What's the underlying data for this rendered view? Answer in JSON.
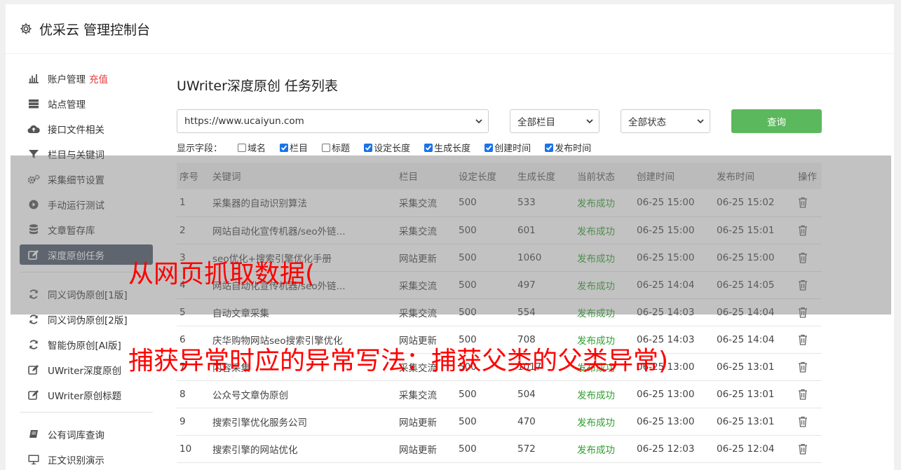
{
  "header": {
    "title": "优采云 管理控制台"
  },
  "sidebar": {
    "items": [
      {
        "label": "账户管理",
        "extra": "充值",
        "icon": "bar-chart-icon"
      },
      {
        "label": "站点管理",
        "icon": "server-icon"
      },
      {
        "label": "接口文件相关",
        "icon": "cloud-upload-icon"
      },
      {
        "label": "栏目与关键词",
        "icon": "filter-icon"
      },
      {
        "label": "采集细节设置",
        "icon": "cogs-icon"
      },
      {
        "label": "手动运行测试",
        "icon": "play-circle-icon"
      },
      {
        "label": "文章暂存库",
        "icon": "database-icon"
      },
      {
        "label": "深度原创任务",
        "icon": "edit-icon",
        "active": true
      }
    ],
    "items2": [
      {
        "label": "同义词伪原创[1版]",
        "icon": "refresh-icon"
      },
      {
        "label": "同义词伪原创[2版]",
        "icon": "refresh-icon"
      },
      {
        "label": "智能伪原创[AI版]",
        "icon": "refresh-icon"
      },
      {
        "label": "UWriter深度原创",
        "icon": "edit-icon"
      },
      {
        "label": "UWriter原创标题",
        "icon": "edit-icon"
      }
    ],
    "items3": [
      {
        "label": "公有词库查询",
        "icon": "book-icon"
      },
      {
        "label": "正文识别演示",
        "icon": "monitor-icon"
      }
    ]
  },
  "main": {
    "title": "UWriter深度原创 任务列表",
    "site_select": "https://www.ucaiyun.com",
    "column_select": "全部栏目",
    "status_select": "全部状态",
    "query_label": "查询",
    "fields_label": "显示字段：",
    "fields": [
      {
        "label": "域名",
        "checked": false
      },
      {
        "label": "栏目",
        "checked": true
      },
      {
        "label": "标题",
        "checked": false
      },
      {
        "label": "设定长度",
        "checked": true
      },
      {
        "label": "生成长度",
        "checked": true
      },
      {
        "label": "创建时间",
        "checked": true
      },
      {
        "label": "发布时间",
        "checked": true
      }
    ]
  },
  "table": {
    "headers": [
      "序号",
      "关键词",
      "栏目",
      "设定长度",
      "生成长度",
      "当前状态",
      "创建时间",
      "发布时间",
      "操作"
    ],
    "rows": [
      [
        "1",
        "采集器的自动识别算法",
        "采集交流",
        "500",
        "533",
        "发布成功",
        "06-25 15:00",
        "06-25 15:02"
      ],
      [
        "2",
        "网站自动化宣传机器/seo外链...",
        "采集交流",
        "500",
        "601",
        "发布成功",
        "06-25 15:00",
        "06-25 15:01"
      ],
      [
        "3",
        "seo优化+搜索引擎优化手册",
        "网站更新",
        "500",
        "1060",
        "发布成功",
        "06-25 15:00",
        "06-25 15:00"
      ],
      [
        "4",
        "网站自动化宣传机器/seo外链...",
        "采集交流",
        "500",
        "497",
        "发布成功",
        "06-25 14:04",
        "06-25 14:05"
      ],
      [
        "5",
        "自动文章采集",
        "采集交流",
        "500",
        "554",
        "发布成功",
        "06-25 14:03",
        "06-25 14:04"
      ],
      [
        "6",
        "庆华购物网站seo搜索引擎优化",
        "网站更新",
        "500",
        "708",
        "发布成功",
        "06-25 14:03",
        "06-25 14:04"
      ],
      [
        "7",
        "内容采集",
        "采集交流",
        "500",
        "1017",
        "发布成功",
        "06-25 13:00",
        "06-25 13:01"
      ],
      [
        "8",
        "公众号文章伪原创",
        "采集交流",
        "500",
        "504",
        "发布成功",
        "06-25 13:00",
        "06-25 13:01"
      ],
      [
        "9",
        "搜索引擎优化服务公司",
        "网站更新",
        "500",
        "470",
        "发布成功",
        "06-25 13:00",
        "06-25 13:01"
      ],
      [
        "10",
        "搜索引擎的网站优化",
        "网站更新",
        "500",
        "572",
        "发布成功",
        "06-25 12:03",
        "06-25 12:04"
      ]
    ]
  },
  "overlay": {
    "line1": "从网页抓取数据(",
    "line2": "捕获异常时应的异常写法：捕获父类的父类异常)"
  }
}
